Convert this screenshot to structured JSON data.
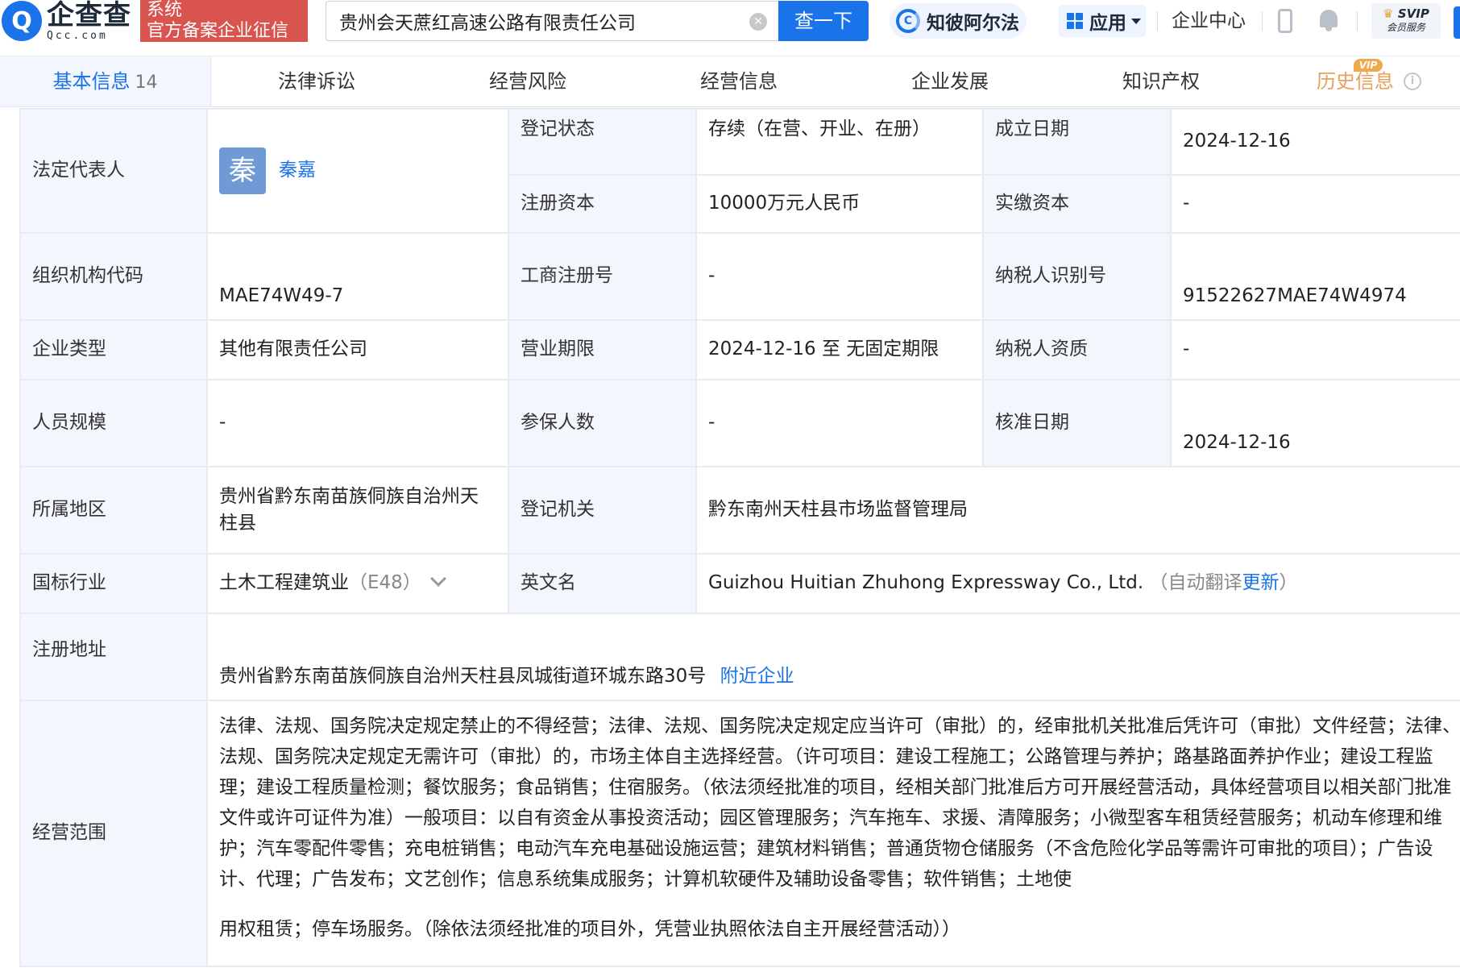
{
  "header": {
    "logo_mark": "Q",
    "logo_cn": "企查查",
    "logo_en": "Qcc.com",
    "badge_line1": "系统",
    "badge_line2": "官方备案企业征信",
    "search_value": "贵州会天蔗红高速公路有限责任公司",
    "search_button": "查一下",
    "ai_label": "知彼阿尔法",
    "app_label": "应用",
    "ent_center": "企业中心",
    "svip_line1": "SVIP",
    "svip_line2": "会员服务"
  },
  "tabs": [
    {
      "label": "基本信息",
      "count": "14"
    },
    {
      "label": "法律诉讼"
    },
    {
      "label": "经营风险"
    },
    {
      "label": "经营信息"
    },
    {
      "label": "企业发展"
    },
    {
      "label": "知识产权"
    },
    {
      "label": "历史信息",
      "tag": "VIP"
    }
  ],
  "info": {
    "legal_rep_label": "法定代表人",
    "legal_rep_avatar": "秦",
    "legal_rep_name": "秦嘉",
    "reg_status_label": "登记状态",
    "reg_status": "存续（在营、开业、在册）",
    "found_date_label": "成立日期",
    "found_date": "2024-12-16",
    "reg_capital_label": "注册资本",
    "reg_capital": "10000万元人民币",
    "paid_capital_label": "实缴资本",
    "paid_capital": "-",
    "org_code_label": "组织机构代码",
    "org_code": "MAE74W49-7",
    "biz_reg_no_label": "工商注册号",
    "biz_reg_no": "-",
    "taxpayer_id_label": "纳税人识别号",
    "taxpayer_id": "91522627MAE74W4974",
    "ent_type_label": "企业类型",
    "ent_type": "其他有限责任公司",
    "biz_term_label": "营业期限",
    "biz_term": "2024-12-16 至 无固定期限",
    "taxpayer_qual_label": "纳税人资质",
    "taxpayer_qual": "-",
    "staff_size_label": "人员规模",
    "staff_size": "-",
    "insured_label": "参保人数",
    "insured": "-",
    "approve_date_label": "核准日期",
    "approve_date": "2024-12-16",
    "region_label": "所属地区",
    "region": "贵州省黔东南苗族侗族自治州天柱县",
    "reg_authority_label": "登记机关",
    "reg_authority": "黔东南州天柱县市场监督管理局",
    "industry_label": "国标行业",
    "industry": "土木工程建筑业",
    "industry_code": "（E48）",
    "en_name_label": "英文名",
    "en_name": "Guizhou Huitian Zhuhong Expressway Co., Ltd.",
    "en_name_note_pre": "（自动翻译",
    "en_name_update": "更新",
    "en_name_note_post": "）",
    "address_label": "注册地址",
    "address": "贵州省黔东南苗族侗族自治州天柱县凤城街道环城东路30号",
    "nearby_link": "附近企业",
    "scope_label": "经营范围",
    "scope_text": "法律、法规、国务院决定规定禁止的不得经营；法律、法规、国务院决定规定应当许可（审批）的，经审批机关批准后凭许可（审批）文件经营；法律、法规、国务院决定规定无需许可（审批）的，市场主体自主选择经营。（许可项目：建设工程施工；公路管理与养护；路基路面养护作业；建设工程监理；建设工程质量检测；餐饮服务；食品销售；住宿服务。（依法须经批准的项目，经相关部门批准后方可开展经营活动，具体经营项目以相关部门批准文件或许可证件为准）一般项目：以自有资金从事投资活动；园区管理服务；汽车拖车、求援、清障服务；小微型客车租赁经营服务；机动车修理和维护；汽车零配件零售；充电桩销售；电动汽车充电基础设施运营；建筑材料销售；普通货物仓储服务（不含危险化学品等需许可审批的项目）；广告设计、代理；广告发布；文艺创作；信息系统集成服务；计算机软硬件及辅助设备零售；软件销售；土地使",
    "scope_text_tail": "用权租赁；停车场服务。（除依法须经批准的项目外，凭营业执照依法自主开展经营活动））"
  }
}
